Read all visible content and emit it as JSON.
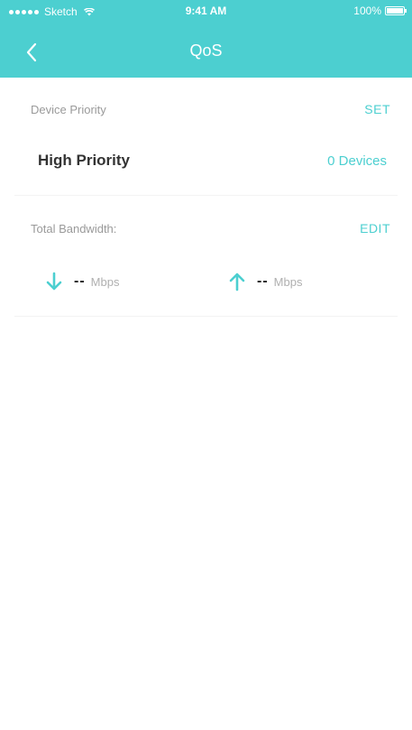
{
  "status_bar": {
    "carrier": "Sketch",
    "time": "9:41 AM",
    "battery": "100%"
  },
  "nav": {
    "title": "QoS",
    "back_icon": "chevron-left-icon"
  },
  "device_priority": {
    "label": "Device Priority",
    "action": "SET",
    "row_label": "High Priority",
    "row_value": "0 Devices"
  },
  "total_bandwidth": {
    "label": "Total Bandwidth:",
    "action": "EDIT",
    "download": {
      "value": "--",
      "unit": "Mbps",
      "icon": "arrow-down-icon"
    },
    "upload": {
      "value": "--",
      "unit": "Mbps",
      "icon": "arrow-up-icon"
    }
  },
  "colors": {
    "accent": "#4ccfd0",
    "text_dark": "#333333",
    "text_muted": "#9a9a9a"
  }
}
